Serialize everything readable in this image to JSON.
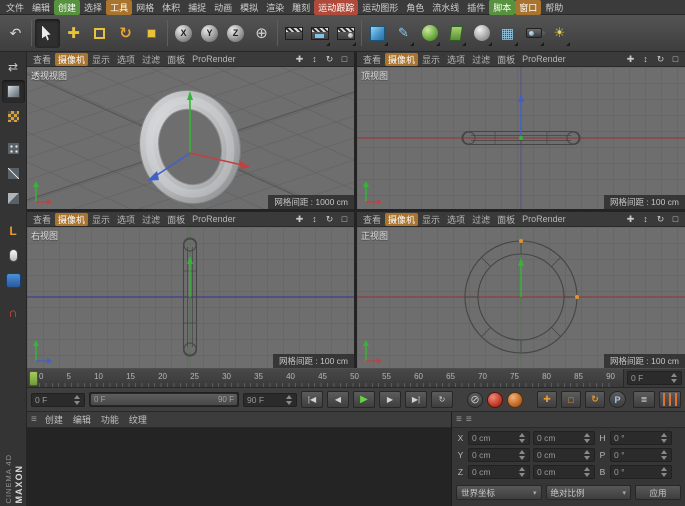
{
  "app": {
    "brand_top": "MAXON",
    "brand_bottom": "CINEMA 4D"
  },
  "menubar": {
    "items": [
      "文件",
      "编辑",
      "创建",
      "选择",
      "工具",
      "网格",
      "体积",
      "捕捉",
      "动画",
      "模拟",
      "渲染",
      "雕刻",
      "运动跟踪",
      "运动图形",
      "角色",
      "流水线",
      "插件",
      "脚本",
      "窗口",
      "帮助"
    ]
  },
  "toolbar": {
    "lock_x": "X",
    "lock_y": "Y",
    "lock_z": "Z"
  },
  "viewports": {
    "menu": [
      "查看",
      "摄像机",
      "显示",
      "选项",
      "过滤",
      "面板",
      "ProRender"
    ],
    "panels": [
      {
        "label": "透视视图",
        "grid_spacing": "网格间距 : 1000 cm"
      },
      {
        "label": "顶视图",
        "grid_spacing": "网格间距 : 100 cm"
      },
      {
        "label": "右视图",
        "grid_spacing": "网格间距 : 100 cm"
      },
      {
        "label": "正视图",
        "grid_spacing": "网格间距 : 100 cm"
      }
    ]
  },
  "timeline": {
    "ticks": [
      "0",
      "5",
      "10",
      "15",
      "20",
      "25",
      "30",
      "35",
      "40",
      "45",
      "50",
      "55",
      "60",
      "65",
      "70",
      "75",
      "80",
      "85",
      "90"
    ],
    "frame_field": "0 F"
  },
  "transport": {
    "current": "0 F",
    "range_start": "0 F",
    "range_end": "90 F",
    "end": "90 F"
  },
  "material_manager": {
    "menu": [
      "创建",
      "编辑",
      "功能",
      "纹理"
    ]
  },
  "coordinates": {
    "rows": [
      {
        "axis": "X",
        "pos": "0 cm",
        "size": "0 cm",
        "rot_axis": "H",
        "rot": "0 °"
      },
      {
        "axis": "Y",
        "pos": "0 cm",
        "size": "0 cm",
        "rot_axis": "P",
        "rot": "0 °"
      },
      {
        "axis": "Z",
        "pos": "0 cm",
        "size": "0 cm",
        "rot_axis": "B",
        "rot": "0 °"
      }
    ],
    "coord_system": "世界坐标",
    "scale_mode": "绝对比例",
    "apply": "应用"
  },
  "icons": {
    "undo": "↶",
    "move": "✚",
    "rotate": "↻",
    "coord_system": "⊕",
    "pen": "✎",
    "grid": "▦",
    "light": "☀",
    "convert": "⇄",
    "magnet": "∩",
    "axis_l": "L",
    "hamburger": "≡",
    "vp_pan": "✚",
    "vp_zoom": "↕",
    "vp_rotate": "↻",
    "vp_toggle": "□",
    "goto_start": "|◀",
    "prev_frame": "◀",
    "play": "▶",
    "next_frame": "▶",
    "goto_end": "▶|",
    "loop": "↻",
    "record": "⊘",
    "key_position": "✚",
    "key_scale": "□",
    "key_rotation": "↻",
    "key_parameter": "P",
    "filter": "≣",
    "select_arrow": "▾"
  },
  "colors": {
    "viewport_bg": "#6e6e6e",
    "axis_x": "#c24040",
    "axis_y": "#35b535",
    "axis_z": "#4060c8",
    "highlight_orange": "#a8742e",
    "highlight_green": "#57923e",
    "highlight_red": "#b04a3a",
    "play_green": "#62d83e",
    "key_orange": "#e89b2e"
  }
}
